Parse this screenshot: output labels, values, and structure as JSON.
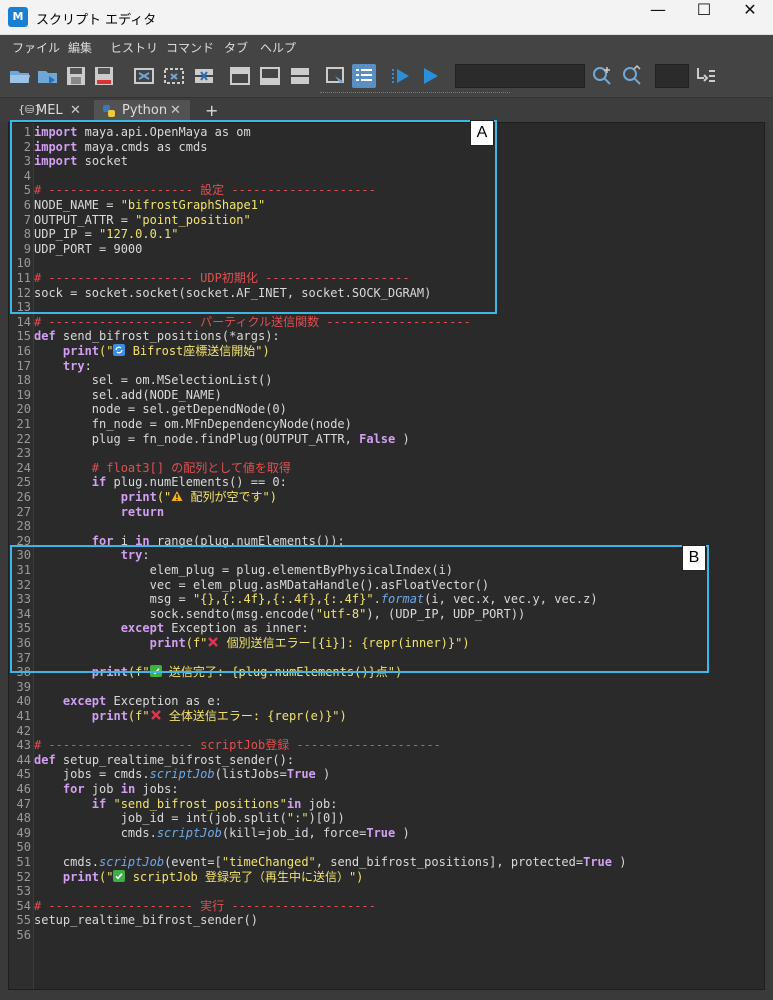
{
  "window": {
    "title": "スクリプト エディタ",
    "app_icon_text": "M",
    "minimize": "—",
    "maximize": "☐",
    "close": "✕"
  },
  "menu": [
    "ファイル",
    "編集",
    "ヒストリ",
    "コマンド",
    "タブ",
    "ヘルプ"
  ],
  "tabs": [
    {
      "label": "MEL",
      "close": "✕"
    },
    {
      "label": "Python",
      "close": "✕"
    }
  ],
  "add_tab": "+",
  "annotations": {
    "a": "A",
    "b": "B"
  },
  "lines": [
    {
      "n": "1",
      "segs": [
        [
          "kw",
          "import"
        ],
        [
          "",
          "maya.api.OpenMaya as om"
        ]
      ]
    },
    {
      "n": "2",
      "segs": [
        [
          "kw",
          "import"
        ],
        [
          "",
          "maya.cmds as cmds"
        ]
      ]
    },
    {
      "n": "3",
      "segs": [
        [
          "kw",
          "import"
        ],
        [
          "",
          "socket"
        ]
      ]
    },
    {
      "n": "4",
      "segs": []
    },
    {
      "n": "5",
      "segs": [
        [
          "cmt",
          "# -------------------- 設定 --------------------"
        ]
      ]
    },
    {
      "n": "6",
      "segs": [
        [
          "",
          "NODE_NAME = "
        ],
        [
          "str",
          "\"bifrostGraphShape1\""
        ]
      ]
    },
    {
      "n": "7",
      "segs": [
        [
          "",
          "OUTPUT_ATTR = "
        ],
        [
          "str",
          "\"point_position\""
        ]
      ]
    },
    {
      "n": "8",
      "segs": [
        [
          "",
          "UDP_IP = "
        ],
        [
          "str",
          "\"127.0.0.1\""
        ]
      ]
    },
    {
      "n": "9",
      "segs": [
        [
          "",
          "UDP_PORT = 9000"
        ]
      ]
    },
    {
      "n": "10",
      "segs": []
    },
    {
      "n": "11",
      "segs": [
        [
          "cmt",
          "# -------------------- UDP初期化 --------------------"
        ]
      ]
    },
    {
      "n": "12",
      "segs": [
        [
          "",
          "sock = socket.socket(socket.AF_INET, socket.SOCK_DGRAM)"
        ]
      ]
    },
    {
      "n": "13",
      "segs": []
    },
    {
      "n": "14",
      "segs": [
        [
          "cmt",
          "# -------------------- パーティクル送信関数 --------------------"
        ]
      ]
    },
    {
      "n": "15",
      "segs": [
        [
          "kw",
          "def"
        ],
        [
          "",
          "send_bifrost_positions(*args):"
        ]
      ]
    },
    {
      "n": "16",
      "segs": [
        [
          "",
          "    "
        ],
        [
          "kw",
          "print"
        ],
        [
          "str",
          "(\""
        ],
        [
          "emoji",
          "🔄"
        ],
        [
          "str",
          " Bifrost座標送信開始\")"
        ]
      ]
    },
    {
      "n": "17",
      "segs": [
        [
          "",
          "    "
        ],
        [
          "kw",
          "try"
        ],
        [
          "",
          ":"
        ]
      ]
    },
    {
      "n": "18",
      "segs": [
        [
          "",
          "        sel = om.MSelectionList()"
        ]
      ]
    },
    {
      "n": "19",
      "segs": [
        [
          "",
          "        sel.add(NODE_NAME)"
        ]
      ]
    },
    {
      "n": "20",
      "segs": [
        [
          "",
          "        node = sel.getDependNode(0)"
        ]
      ]
    },
    {
      "n": "21",
      "segs": [
        [
          "",
          "        fn_node = om.MFnDependencyNode(node)"
        ]
      ]
    },
    {
      "n": "22",
      "segs": [
        [
          "",
          "        plug = fn_node.findPlug(OUTPUT_ATTR, "
        ],
        [
          "kw",
          "False"
        ],
        [
          "",
          ")"
        ]
      ]
    },
    {
      "n": "23",
      "segs": []
    },
    {
      "n": "24",
      "segs": [
        [
          "cmt",
          "        # float3[] の配列として値を取得"
        ]
      ]
    },
    {
      "n": "25",
      "segs": [
        [
          "",
          "        "
        ],
        [
          "kw",
          "if"
        ],
        [
          "",
          "plug.numElements() == 0:"
        ]
      ]
    },
    {
      "n": "26",
      "segs": [
        [
          "",
          "            "
        ],
        [
          "kw",
          "print"
        ],
        [
          "str",
          "(\""
        ],
        [
          "emoji",
          "⚠️"
        ],
        [
          "str",
          " 配列が空です\")"
        ]
      ]
    },
    {
      "n": "27",
      "segs": [
        [
          "",
          "            "
        ],
        [
          "kw",
          "return"
        ]
      ]
    },
    {
      "n": "28",
      "segs": []
    },
    {
      "n": "29",
      "segs": [
        [
          "",
          "        "
        ],
        [
          "kw",
          "for"
        ],
        [
          "",
          "i "
        ],
        [
          "kw",
          "in"
        ],
        [
          "",
          "range(plug.numElements()):"
        ]
      ]
    },
    {
      "n": "30",
      "segs": [
        [
          "",
          "            "
        ],
        [
          "kw",
          "try"
        ],
        [
          "",
          ":"
        ]
      ]
    },
    {
      "n": "31",
      "segs": [
        [
          "",
          "                elem_plug = plug.elementByPhysicalIndex(i)"
        ]
      ]
    },
    {
      "n": "32",
      "segs": [
        [
          "",
          "                vec = elem_plug.asMDataHandle().asFloatVector()"
        ]
      ]
    },
    {
      "n": "33",
      "segs": [
        [
          "",
          "                msg = "
        ],
        [
          "str",
          "\"{},{:.4f},{:.4f},{:.4f}\""
        ],
        [
          "",
          "."
        ],
        [
          "fn",
          "format"
        ],
        [
          "",
          "(i, vec.x, vec.y, vec.z)"
        ]
      ]
    },
    {
      "n": "34",
      "segs": [
        [
          "",
          "                sock.sendto(msg.encode("
        ],
        [
          "str",
          "\"utf-8\""
        ],
        [
          "",
          "), (UDP_IP, UDP_PORT))"
        ]
      ]
    },
    {
      "n": "35",
      "segs": [
        [
          "",
          "            "
        ],
        [
          "kw",
          "except"
        ],
        [
          "",
          "Exception as inner:"
        ]
      ]
    },
    {
      "n": "36",
      "segs": [
        [
          "",
          "                "
        ],
        [
          "kw",
          "print"
        ],
        [
          "str",
          "(f\""
        ],
        [
          "emoji",
          "❌"
        ],
        [
          "str",
          " 個別送信エラー[{i}]: {repr(inner)}\")"
        ]
      ]
    },
    {
      "n": "37",
      "segs": []
    },
    {
      "n": "38",
      "segs": [
        [
          "",
          "        "
        ],
        [
          "kw",
          "print"
        ],
        [
          "str",
          "(f\""
        ],
        [
          "emoji",
          "✅"
        ],
        [
          "str",
          " 送信完了: {plug.numElements()}点\")"
        ]
      ]
    },
    {
      "n": "39",
      "segs": []
    },
    {
      "n": "40",
      "segs": [
        [
          "",
          "    "
        ],
        [
          "kw",
          "except"
        ],
        [
          "",
          "Exception as e:"
        ]
      ]
    },
    {
      "n": "41",
      "segs": [
        [
          "",
          "        "
        ],
        [
          "kw",
          "print"
        ],
        [
          "str",
          "(f\""
        ],
        [
          "emoji",
          "❌"
        ],
        [
          "str",
          " 全体送信エラー: {repr(e)}\")"
        ]
      ]
    },
    {
      "n": "42",
      "segs": []
    },
    {
      "n": "43",
      "segs": [
        [
          "cmt",
          "# -------------------- scriptJob登録 --------------------"
        ]
      ]
    },
    {
      "n": "44",
      "segs": [
        [
          "kw",
          "def"
        ],
        [
          "",
          "setup_realtime_bifrost_sender():"
        ]
      ]
    },
    {
      "n": "45",
      "segs": [
        [
          "",
          "    jobs = cmds."
        ],
        [
          "fn",
          "scriptJob"
        ],
        [
          "",
          "(listJobs="
        ],
        [
          "kw",
          "True"
        ],
        [
          "",
          ")"
        ]
      ]
    },
    {
      "n": "46",
      "segs": [
        [
          "",
          "    "
        ],
        [
          "kw",
          "for"
        ],
        [
          "",
          "job "
        ],
        [
          "kw",
          "in"
        ],
        [
          "",
          "jobs:"
        ]
      ]
    },
    {
      "n": "47",
      "segs": [
        [
          "",
          "        "
        ],
        [
          "kw",
          "if"
        ],
        [
          "str",
          "\"send_bifrost_positions\""
        ],
        [
          "",
          ""
        ],
        [
          "kw",
          "in"
        ],
        [
          "",
          "job:"
        ]
      ]
    },
    {
      "n": "48",
      "segs": [
        [
          "",
          "            job_id = int(job.split("
        ],
        [
          "str",
          "\":\""
        ],
        [
          "",
          ")[0])"
        ]
      ]
    },
    {
      "n": "49",
      "segs": [
        [
          "",
          "            cmds."
        ],
        [
          "fn",
          "scriptJob"
        ],
        [
          "",
          "(kill=job_id, force="
        ],
        [
          "kw",
          "True"
        ],
        [
          "",
          ")"
        ]
      ]
    },
    {
      "n": "50",
      "segs": []
    },
    {
      "n": "51",
      "segs": [
        [
          "",
          "    cmds."
        ],
        [
          "fn",
          "scriptJob"
        ],
        [
          "",
          "(event=["
        ],
        [
          "str",
          "\"timeChanged\""
        ],
        [
          "",
          ", send_bifrost_positions], protected="
        ],
        [
          "kw",
          "True"
        ],
        [
          "",
          ")"
        ]
      ]
    },
    {
      "n": "52",
      "segs": [
        [
          "",
          "    "
        ],
        [
          "kw",
          "print"
        ],
        [
          "str",
          "(\""
        ],
        [
          "emoji",
          "✅"
        ],
        [
          "str",
          " scriptJob 登録完了（再生中に送信）\")"
        ]
      ]
    },
    {
      "n": "53",
      "segs": []
    },
    {
      "n": "54",
      "segs": [
        [
          "cmt",
          "# -------------------- 実行 --------------------"
        ]
      ]
    },
    {
      "n": "55",
      "segs": [
        [
          "",
          "setup_realtime_bifrost_sender()"
        ]
      ]
    },
    {
      "n": "56",
      "segs": []
    }
  ]
}
